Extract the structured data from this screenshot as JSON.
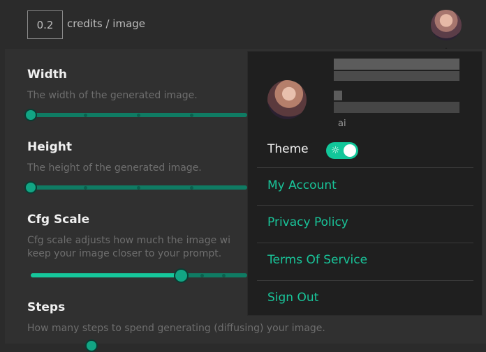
{
  "topbar": {
    "credit_value": "0.2",
    "credit_label": "credits / image"
  },
  "settings": {
    "width": {
      "label": "Width",
      "description": "The width of the generated image."
    },
    "height": {
      "label": "Height",
      "description": "The height of the generated image."
    },
    "cfg": {
      "label": "Cfg Scale",
      "description_line1": "Cfg scale adjusts how much the image wi",
      "description_line2": "keep your image closer to your prompt."
    },
    "steps": {
      "label": "Steps",
      "description": "How many steps to spend generating (diffusing) your image."
    }
  },
  "account_menu": {
    "username": "ai",
    "theme_label": "Theme",
    "theme_toggle_on": true,
    "items": [
      {
        "label": "My Account"
      },
      {
        "label": "Privacy Policy"
      },
      {
        "label": "Terms Of Service"
      },
      {
        "label": "Sign Out"
      }
    ]
  },
  "colors": {
    "accent": "#19c59a",
    "slider_track": "#0f7b63",
    "background": "#2b2b2b",
    "menu_background": "#1f1f1f"
  }
}
